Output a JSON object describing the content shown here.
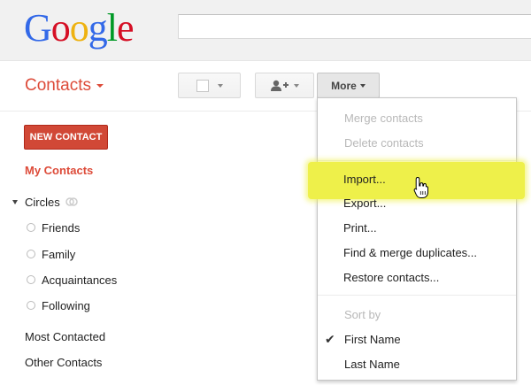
{
  "logo": {
    "letters": [
      {
        "ch": "G",
        "color": "#3369e8"
      },
      {
        "ch": "o",
        "color": "#d50f25"
      },
      {
        "ch": "o",
        "color": "#eeb211"
      },
      {
        "ch": "g",
        "color": "#3369e8"
      },
      {
        "ch": "l",
        "color": "#009925"
      },
      {
        "ch": "e",
        "color": "#d50f25"
      }
    ]
  },
  "app_title": "Contacts",
  "toolbar": {
    "more_label": "More"
  },
  "sidebar": {
    "new_contact": "NEW CONTACT",
    "my_contacts": "My Contacts",
    "circles": "Circles",
    "circle_items": [
      "Friends",
      "Family",
      "Acquaintances",
      "Following"
    ],
    "most_contacted": "Most Contacted",
    "other_contacts": "Other Contacts"
  },
  "menu": {
    "merge": "Merge contacts",
    "delete": "Delete contacts",
    "import": "Import...",
    "export": "Export...",
    "print": "Print...",
    "find_merge": "Find & merge duplicates...",
    "restore": "Restore contacts...",
    "sort_by": "Sort by",
    "first_name": "First Name",
    "last_name": "Last Name"
  },
  "colors": {
    "accent": "#dd4b39",
    "highlight": "#eef04a"
  }
}
